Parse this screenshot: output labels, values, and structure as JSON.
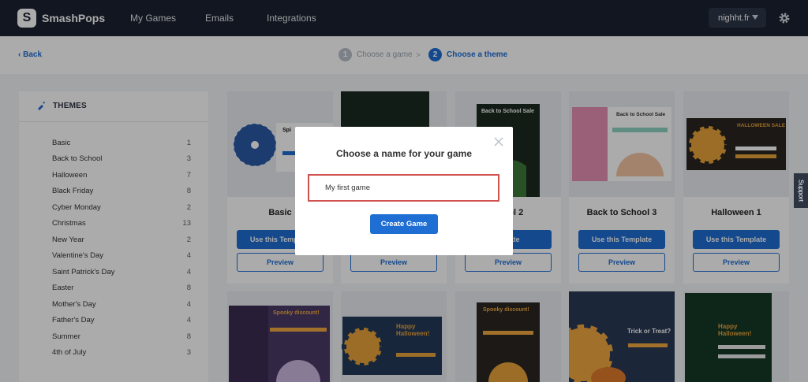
{
  "app": {
    "brand": "SmashPops",
    "logo_letter": "S"
  },
  "nav": {
    "items": [
      "My Games",
      "Emails",
      "Integrations"
    ],
    "account": "nighht.fr"
  },
  "subheader": {
    "back_label": "Back",
    "steps": [
      {
        "num": "1",
        "label": "Choose a game"
      },
      {
        "num": "2",
        "label": "Choose a theme"
      }
    ],
    "separator": ">"
  },
  "sidebar": {
    "title": "THEMES",
    "items": [
      {
        "label": "Basic",
        "count": "1"
      },
      {
        "label": "Back to School",
        "count": "3"
      },
      {
        "label": "Halloween",
        "count": "7"
      },
      {
        "label": "Black Friday",
        "count": "8"
      },
      {
        "label": "Cyber Monday",
        "count": "2"
      },
      {
        "label": "Christmas",
        "count": "13"
      },
      {
        "label": "New Year",
        "count": "2"
      },
      {
        "label": "Valentine's Day",
        "count": "4"
      },
      {
        "label": "Saint Patrick's Day",
        "count": "4"
      },
      {
        "label": "Easter",
        "count": "8"
      },
      {
        "label": "Mother's Day",
        "count": "4"
      },
      {
        "label": "Father's Day",
        "count": "4"
      },
      {
        "label": "Summer",
        "count": "8"
      },
      {
        "label": "4th of July",
        "count": "3"
      }
    ]
  },
  "cards": [
    {
      "title": "Basic",
      "use_label": "Use this Template",
      "preview_label": "Preview",
      "thumb_heading": "Spi"
    },
    {
      "title": "",
      "use_label": "",
      "preview_label": "Preview"
    },
    {
      "title": "chool 2",
      "use_label": "mplate",
      "preview_label": "Preview",
      "thumb_heading": "Back to School Sale"
    },
    {
      "title": "Back to School 3",
      "use_label": "Use this Template",
      "preview_label": "Preview",
      "thumb_heading": "Back to School Sale"
    },
    {
      "title": "Halloween 1",
      "use_label": "Use this Template",
      "preview_label": "Preview",
      "thumb_heading": "HALLOWEEN SALE"
    }
  ],
  "cards_row2": [
    {
      "thumb_heading": "Spooky discount!"
    },
    {
      "thumb_heading": "Happy Halloween!"
    },
    {
      "thumb_heading": "Spooky discount!"
    },
    {
      "thumb_heading": "Trick or Treat?"
    },
    {
      "thumb_heading": "Happy Halloween!"
    }
  ],
  "modal": {
    "title": "Choose a name for your game",
    "input_value": "My first game",
    "button_label": "Create Game"
  },
  "support_label": "Support",
  "colors": {
    "primary": "#1f6ed4",
    "nav_bg": "#1a2230",
    "input_border": "#d0524f"
  }
}
